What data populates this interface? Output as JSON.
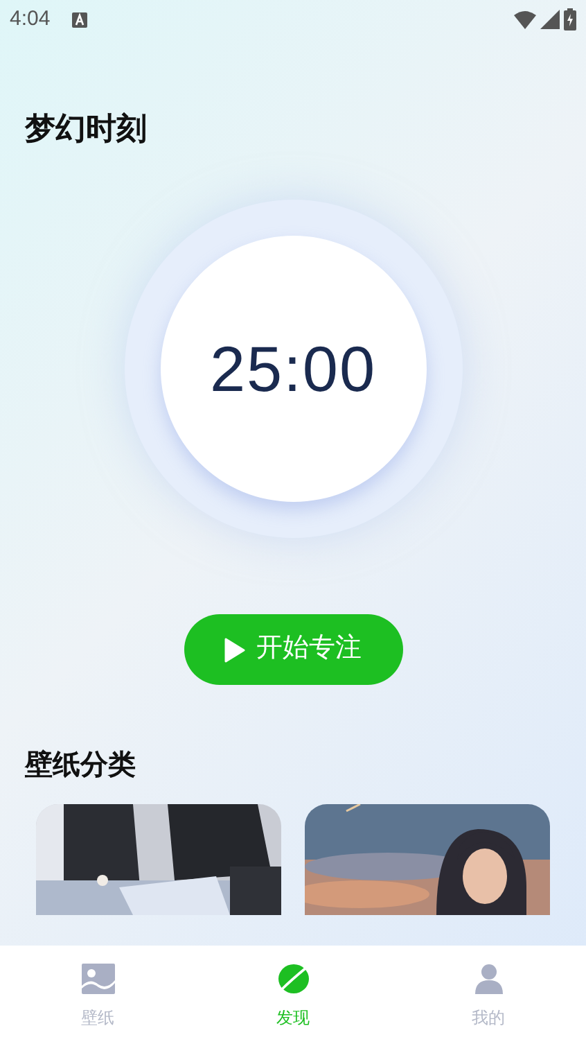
{
  "status_bar": {
    "time": "4:04"
  },
  "title": "梦幻时刻",
  "timer": {
    "display": "25:00"
  },
  "start_button": {
    "label": "开始专注"
  },
  "categories": {
    "heading": "壁纸分类"
  },
  "bottom_nav": [
    {
      "label": "壁纸",
      "selected": false
    },
    {
      "label": "发现",
      "selected": true
    },
    {
      "label": "我的",
      "selected": false
    }
  ]
}
